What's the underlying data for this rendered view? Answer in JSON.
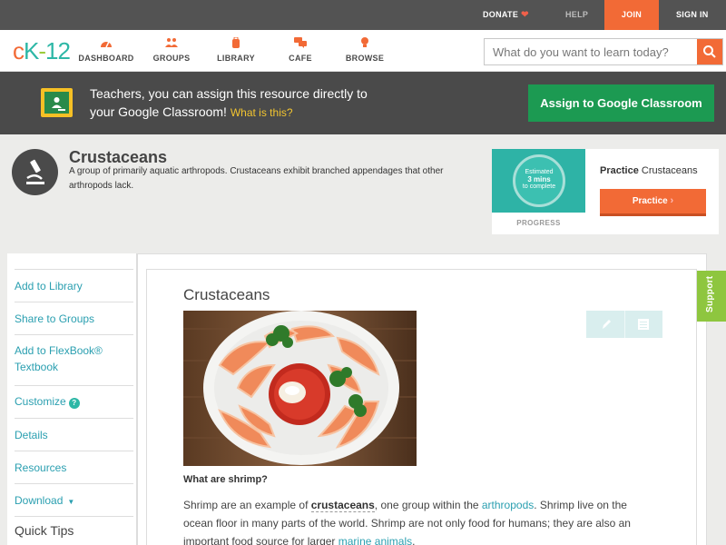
{
  "topbar": {
    "donate": "DONATE",
    "help": "HELP",
    "join": "JOIN",
    "signin": "SIGN IN"
  },
  "nav": {
    "logo": {
      "c": "c",
      "k": "K",
      "dash": "-",
      "n": "12"
    },
    "items": [
      {
        "label": "DASHBOARD",
        "icon": "gauge-icon"
      },
      {
        "label": "GROUPS",
        "icon": "people-icon"
      },
      {
        "label": "LIBRARY",
        "icon": "backpack-icon"
      },
      {
        "label": "CAFE",
        "icon": "chat-icon"
      },
      {
        "label": "BROWSE",
        "icon": "lightbulb-icon"
      }
    ],
    "search_placeholder": "What do you want to learn today?"
  },
  "banner": {
    "line1": "Teachers, you can assign this resource directly to",
    "line2": "your Google Classroom!",
    "what": "What is this?",
    "assign_label": "Assign to Google Classroom"
  },
  "concept": {
    "title": "Crustaceans",
    "description": "A group of primarily aquatic arthropods. Crustaceans exhibit branched appendages that other arthropods lack."
  },
  "practice": {
    "estimated": "Estimated",
    "mins": "3 mins",
    "to_complete": "to complete",
    "progress": "PROGRESS",
    "title_bold": "Practice",
    "title_rest": "Crustaceans",
    "button": "Practice"
  },
  "sidebar": {
    "items": [
      {
        "label": "Add to Library"
      },
      {
        "label": "Share to Groups"
      },
      {
        "label": "Add to FlexBook® Textbook"
      },
      {
        "label": "Customize"
      },
      {
        "label": "Details"
      },
      {
        "label": "Resources"
      },
      {
        "label": "Download"
      }
    ],
    "help_glyph": "?",
    "quick_tips": "Quick Tips"
  },
  "article": {
    "title": "Crustaceans",
    "question": "What are shrimp?",
    "p1_a": "Shrimp are an example of ",
    "p1_term": "crustaceans",
    "p1_b": ", one group within the ",
    "p1_link": "arthropods",
    "p1_c": ". Shrimp live on the ocean floor in many parts of the world. Shrimp are not only food for humans; they are also an important food source for larger ",
    "p1_link2": "marine animals",
    "p1_d": "."
  },
  "support": "Support",
  "colors": {
    "accent": "#f26a36",
    "teal": "#2db7a6",
    "google_green": "#1c9a52",
    "support_green": "#8ec63f"
  }
}
